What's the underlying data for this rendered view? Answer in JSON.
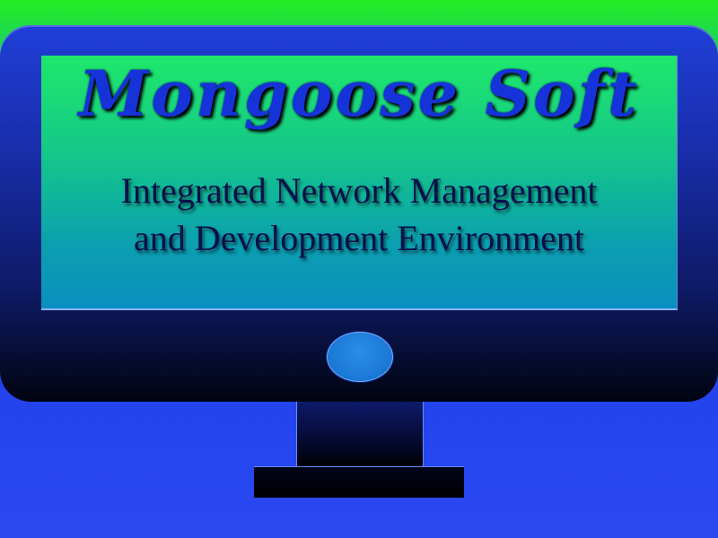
{
  "logo": {
    "brand_name": "Mongoose Soft",
    "tagline_line1": "Integrated Network Management",
    "tagline_line2": "and Development Environment"
  },
  "colors": {
    "background_top": "#22ee22",
    "background_bottom": "#2244ee",
    "bezel": "#1a2fb0",
    "screen_top": "#1ee86a",
    "screen_bottom": "#0a90c0",
    "brand_text": "#1533d8",
    "tagline_text": "#06104a",
    "power_button": "#1a78d4"
  },
  "icons": {
    "monitor": "monitor-icon",
    "power_button": "power-button-icon"
  }
}
